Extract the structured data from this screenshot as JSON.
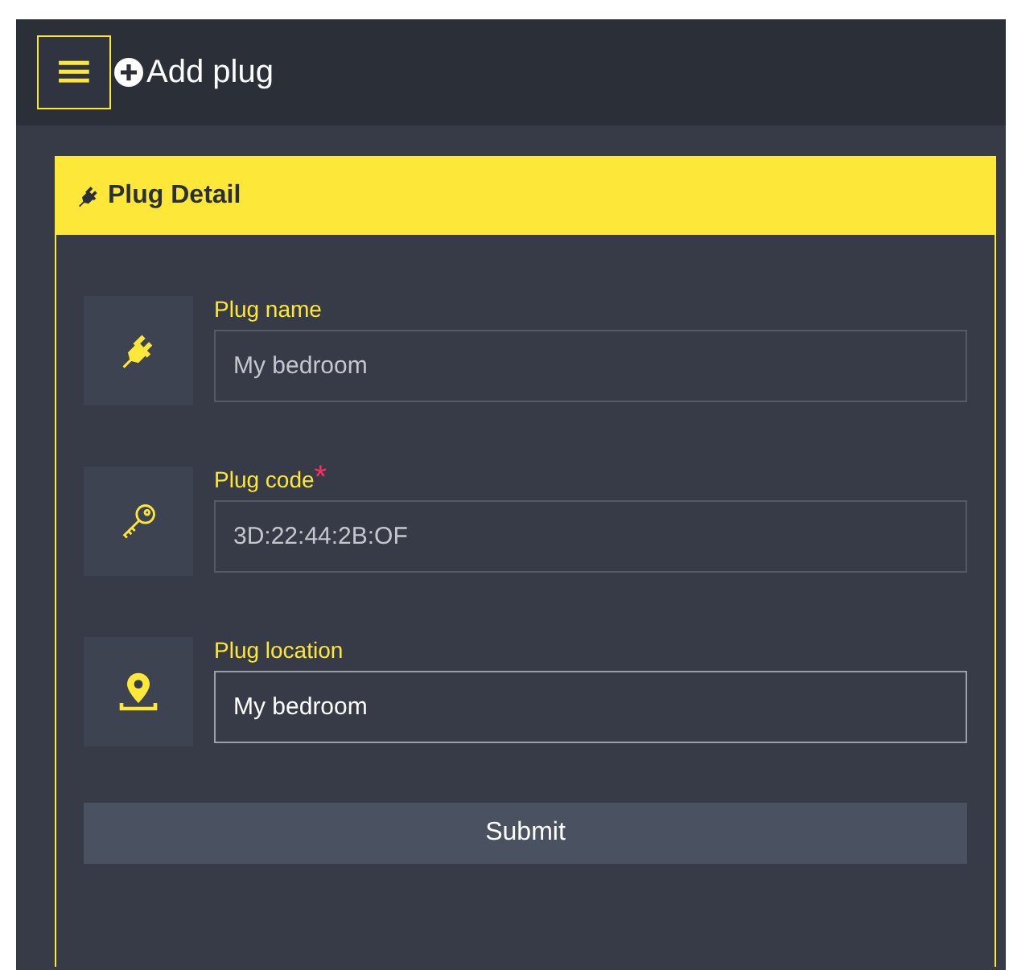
{
  "header": {
    "menu_icon": "≡",
    "title": "Add plug"
  },
  "card": {
    "title": "Plug Detail",
    "fields": [
      {
        "kind": "plug",
        "label": "Plug name",
        "placeholder": "My bedroom",
        "focused": false
      },
      {
        "kind": "key",
        "label": "Plug code",
        "required_mark": "*",
        "placeholder": "3D:22:44:2B:OF",
        "focused": false
      },
      {
        "kind": "pin",
        "label": "Plug location",
        "value": "My bedroom",
        "focused": true
      }
    ],
    "submit": "Submit"
  }
}
